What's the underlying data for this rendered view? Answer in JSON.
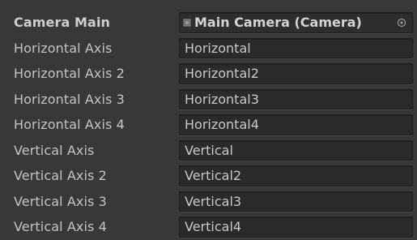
{
  "inspector": {
    "camera": {
      "label": "Camera Main",
      "value": "Main Camera (Camera)",
      "icon": "camera-object-icon",
      "picker_icon": "object-picker-icon"
    },
    "axes": [
      {
        "label": "Horizontal Axis",
        "value": "Horizontal"
      },
      {
        "label": "Horizontal Axis 2",
        "value": "Horizontal2"
      },
      {
        "label": "Horizontal Axis 3",
        "value": "Horizontal3"
      },
      {
        "label": "Horizontal Axis 4",
        "value": "Horizontal4"
      },
      {
        "label": "Vertical Axis",
        "value": "Vertical"
      },
      {
        "label": "Vertical Axis 2",
        "value": "Vertical2"
      },
      {
        "label": "Vertical Axis 3",
        "value": "Vertical3"
      },
      {
        "label": "Vertical Axis 4",
        "value": "Vertical4"
      }
    ]
  },
  "colors": {
    "panel_background": "#383838",
    "field_background": "#2a2a2a",
    "label_text": "#c4c4c4",
    "field_text": "#c8c8c8"
  }
}
